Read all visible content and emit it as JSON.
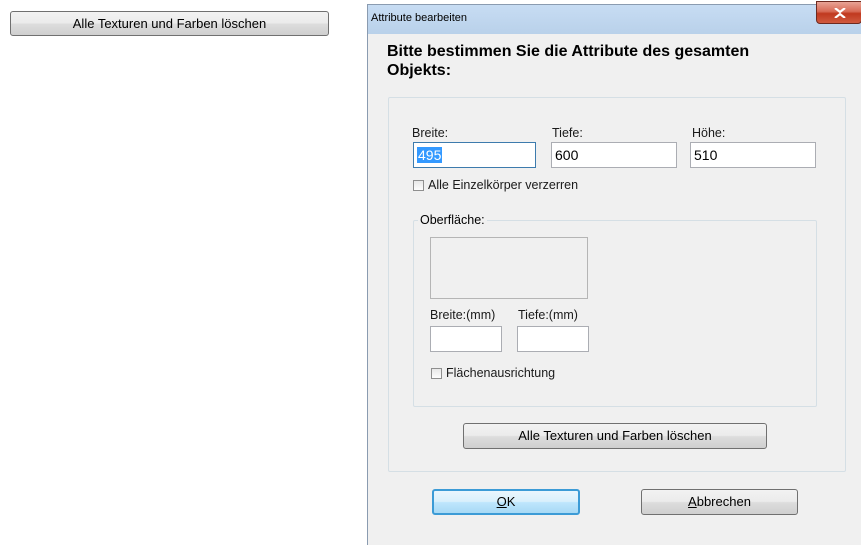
{
  "outside": {
    "reset_button": "Alle Texturen und Farben löschen"
  },
  "dialog": {
    "title": "Attribute bearbeiten",
    "heading": "Bitte bestimmen Sie die Attribute des gesamten Objekts:",
    "dimensions": {
      "breite_label": "Breite:",
      "breite_value": "495",
      "tiefe_label": "Tiefe:",
      "tiefe_value": "600",
      "hoehe_label": "Höhe:",
      "hoehe_value": "510"
    },
    "distort_checkbox": {
      "label": "Alle Einzelkörper verzerren",
      "checked": false
    },
    "surface": {
      "legend": "Oberfläche:",
      "breite_mm_label": "Breite:(mm)",
      "breite_mm_value": "",
      "tiefe_mm_label": "Tiefe:(mm)",
      "tiefe_mm_value": "",
      "orientation_checkbox": {
        "label": "Flächenausrichtung",
        "checked": false
      }
    },
    "reset_button": "Alle Texturen und Farben löschen",
    "ok_button": {
      "accel": "O",
      "rest": "K"
    },
    "cancel_button": {
      "accel": "A",
      "rest": "bbrechen"
    },
    "close_icon": "close-icon"
  }
}
